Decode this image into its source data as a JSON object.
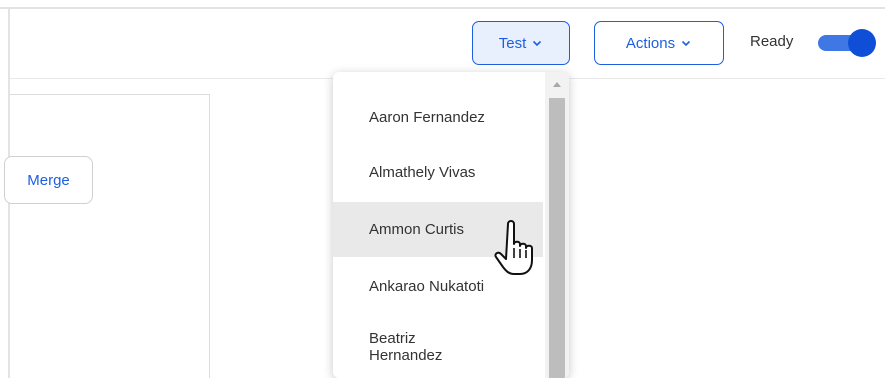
{
  "header": {
    "test_button": {
      "label": "Test",
      "icon": "chevron-down-icon"
    },
    "actions_button": {
      "label": "Actions",
      "icon": "chevron-down-icon"
    },
    "ready_toggle": {
      "label": "Ready",
      "on": true
    }
  },
  "left_panel": {
    "merge_button_label": "Merge"
  },
  "dropdown": {
    "items": [
      {
        "label": "Aaron Fernandez"
      },
      {
        "label": "Almathely Vivas"
      },
      {
        "label": "Ammon Curtis",
        "hovered": true
      },
      {
        "label": "Ankarao Nukatoti"
      },
      {
        "label": "Beatriz",
        "label_line2": "Hernandez"
      }
    ]
  },
  "colors": {
    "accent": "#1d5fe0",
    "hover_bg": "#e9e9e9",
    "border": "#e3e3e3"
  },
  "cursor": {
    "icon": "hand-pointer-icon"
  }
}
